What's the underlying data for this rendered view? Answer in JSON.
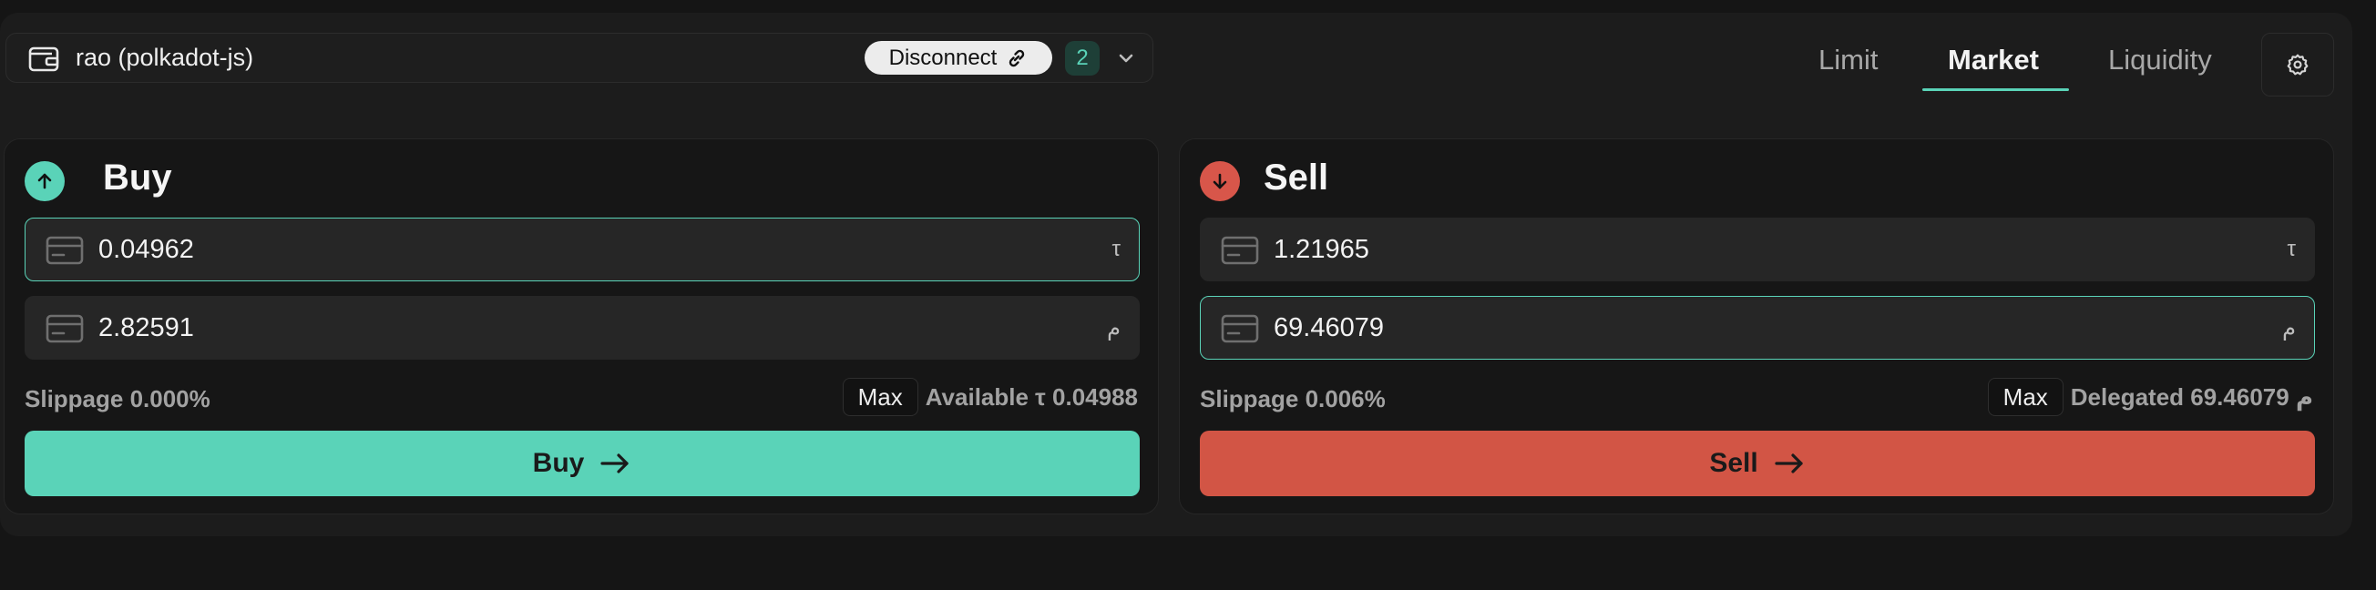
{
  "wallet": {
    "name": "rao (polkadot-js)",
    "disconnect_label": "Disconnect",
    "count": "2"
  },
  "tabs": [
    {
      "label": "Limit",
      "active": false
    },
    {
      "label": "Market",
      "active": true
    },
    {
      "label": "Liquidity",
      "active": false
    }
  ],
  "buy": {
    "title": "Buy",
    "input_pay": {
      "value": "0.04962",
      "unit": "τ"
    },
    "input_receive": {
      "value": "2.82591",
      "unit": "م"
    },
    "slippage": "Slippage 0.000%",
    "max_label": "Max",
    "balance_label": "Available τ 0.04988",
    "action_label": "Buy"
  },
  "sell": {
    "title": "Sell",
    "input_receive": {
      "value": "1.21965",
      "unit": "τ"
    },
    "input_pay": {
      "value": "69.46079",
      "unit": "م"
    },
    "slippage": "Slippage 0.006%",
    "max_label": "Max",
    "balance_label": "Delegated 69.46079 م",
    "action_label": "Sell"
  },
  "colors": {
    "accent": "#5ad3b8",
    "danger": "#d25545",
    "background": "#151515",
    "panel": "#1c1c1c"
  },
  "icons": {
    "wallet": "wallet-icon",
    "disconnect": "link-icon",
    "dropdown": "chevron-down-icon",
    "settings": "gear-icon",
    "buy": "arrow-up-icon",
    "sell": "arrow-down-icon",
    "field": "card-icon",
    "action": "arrow-right-icon"
  }
}
